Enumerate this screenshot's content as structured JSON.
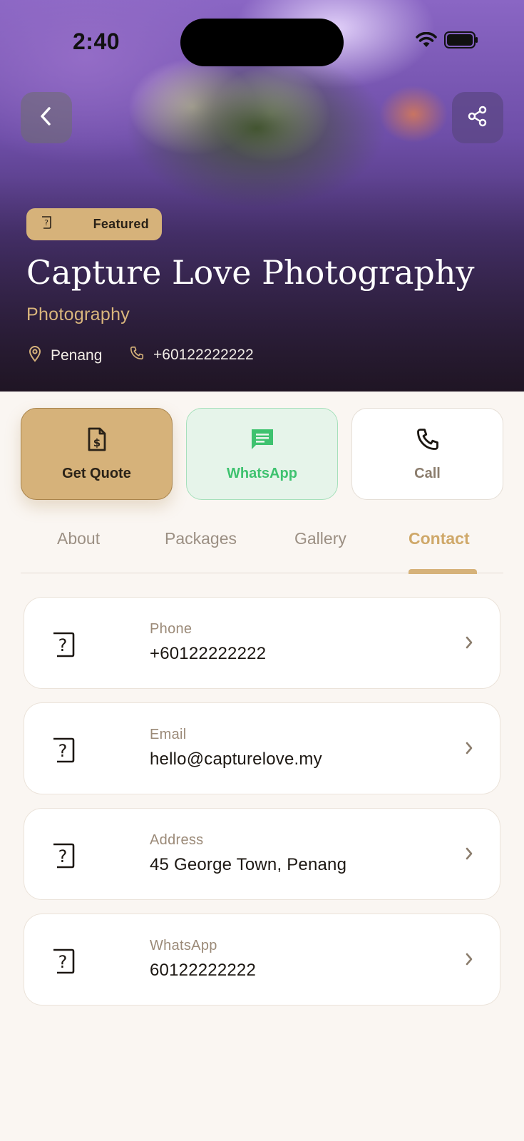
{
  "status_bar": {
    "time": "2:40"
  },
  "hero": {
    "badge": "Featured",
    "title": "Capture Love Photography",
    "category": "Photography",
    "location": "Penang",
    "phone": "+60122222222"
  },
  "actions": {
    "quote": "Get Quote",
    "whatsapp": "WhatsApp",
    "call": "Call"
  },
  "tabs": [
    {
      "label": "About"
    },
    {
      "label": "Packages"
    },
    {
      "label": "Gallery"
    },
    {
      "label": "Contact",
      "active": true
    }
  ],
  "contacts": [
    {
      "label": "Phone",
      "value": "+60122222222"
    },
    {
      "label": "Email",
      "value": "hello@capturelove.my"
    },
    {
      "label": "Address",
      "value": "45 George Town, Penang"
    },
    {
      "label": "WhatsApp",
      "value": "60122222222"
    }
  ],
  "colors": {
    "accent_gold": "#d6b27a",
    "whatsapp_green": "#3ec26f",
    "background": "#faf6f2"
  }
}
